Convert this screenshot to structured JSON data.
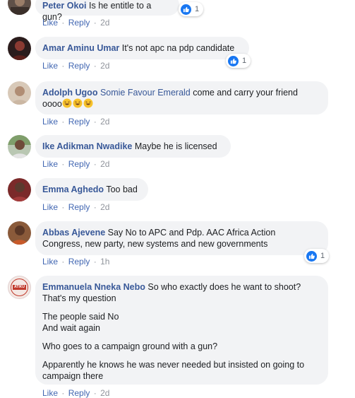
{
  "actions": {
    "like": "Like",
    "reply": "Reply",
    "sep": "·"
  },
  "comments": [
    {
      "author": "Peter Okoi",
      "text": "Is he entitle to a gun?",
      "time": "2d",
      "reactions": "1"
    },
    {
      "author": "Amar Aminu Umar",
      "text": "It's not apc na pdp candidate",
      "time": "2d",
      "reactions": "1"
    },
    {
      "author": "Adolph Ugoo",
      "mention": "Somie Favour Emerald",
      "text": "come and carry your friend",
      "text2": "oooo",
      "time": "2d"
    },
    {
      "author": "Ike Adikman Nwadike",
      "text": "Maybe he is licensed",
      "time": "2d"
    },
    {
      "author": "Emma Aghedo",
      "text": "Too bad",
      "time": "2d"
    },
    {
      "author": "Abbas Ajevene",
      "text": "Say No to APC and Pdp. AAC Africa Action",
      "text2": "Congress, new party, new systems and new governments",
      "time": "1h",
      "reactions": "1"
    },
    {
      "author": "Emmanuela Nneka Nebo",
      "text": "So who exactly does he want to shoot?",
      "text2": "That's my question",
      "p2a": "The people said No",
      "p2b": "And wait again",
      "p3": "Who goes to a campaign ground with a gun?",
      "p4a": "Apparently he knows he was never needed but insisted on going to",
      "p4b": "campaign there",
      "time": "2d",
      "avatar_text": "ATIKU"
    }
  ],
  "colors": {
    "link": "#385898",
    "bubble": "#f2f3f5",
    "like_blue": "#1877f2",
    "meta": "#90949c"
  }
}
